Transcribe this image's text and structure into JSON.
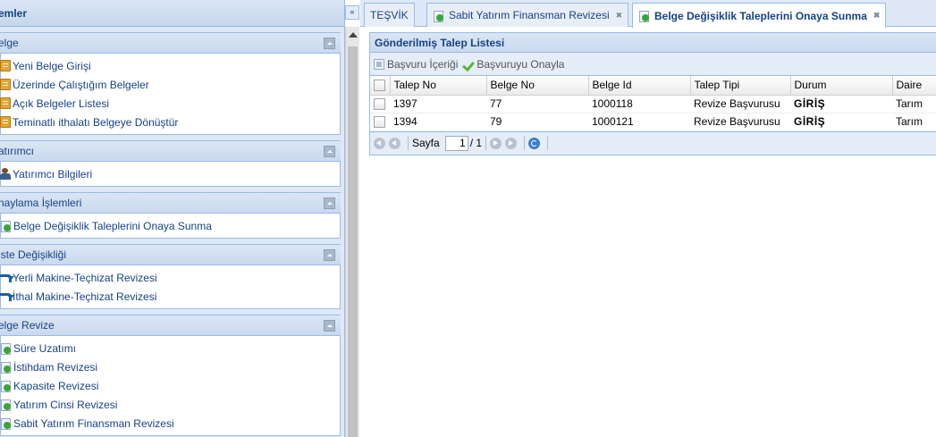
{
  "sidebar": {
    "title": "emler",
    "panels": [
      {
        "title": "elge",
        "items": [
          {
            "label": "Yeni Belge Girişi",
            "icon": "document-icon"
          },
          {
            "label": "Üzerinde Çalıştığım Belgeler",
            "icon": "document-icon"
          },
          {
            "label": "Açık Belgeler Listesi",
            "icon": "document-icon"
          },
          {
            "label": "Teminatlı ithalatı Belgeye Dönüştür",
            "icon": "document-icon"
          }
        ]
      },
      {
        "title": "atırımcı",
        "items": [
          {
            "label": "Yatırımcı Bilgileri",
            "icon": "user-icon"
          }
        ]
      },
      {
        "title": "naylama İşlemleri",
        "items": [
          {
            "label": "Belge Değişiklik Taleplerini Onaya Sunma",
            "icon": "page-go-icon"
          }
        ]
      },
      {
        "title": "iste Değişikliği",
        "items": [
          {
            "label": "Yerli Makine-Teçhizat Revizesi",
            "icon": "arrow-icon"
          },
          {
            "label": "İthal Makine-Teçhizat Revizesi",
            "icon": "arrow-icon"
          }
        ]
      },
      {
        "title": "elge Revize",
        "items": [
          {
            "label": "Süre Uzatımı",
            "icon": "page-go-icon"
          },
          {
            "label": "İstihdam Revizesi",
            "icon": "page-go-icon"
          },
          {
            "label": "Kapasite Revizesi",
            "icon": "page-go-icon"
          },
          {
            "label": "Yatırım Cinsi Revizesi",
            "icon": "page-go-icon"
          },
          {
            "label": "Sabit Yatırım Finansman Revizesi",
            "icon": "page-go-icon"
          }
        ]
      }
    ]
  },
  "tabs": [
    {
      "label": "TEŞVİK",
      "closable": false
    },
    {
      "label": "Sabit Yatırım Finansman Revizesi",
      "closable": true
    },
    {
      "label": "Belge Değişiklik Taleplerini Onaya Sunma",
      "closable": true
    }
  ],
  "grid": {
    "title": "Gönderilmiş Talep Listesi",
    "toolbar": {
      "view_label": "Başvuru İçeriği",
      "approve_label": "Başvuruyu Onayla"
    },
    "columns": [
      "Talep No",
      "Belge No",
      "Belge Id",
      "Talep Tipi",
      "Durum",
      "Daire"
    ],
    "rows": [
      {
        "talep_no": "1397",
        "belge_no": "77",
        "belge_id": "1000118",
        "talep_tipi": "Revize Başvurusu",
        "durum": "GİRİŞ",
        "daire": "Tarım"
      },
      {
        "talep_no": "1394",
        "belge_no": "79",
        "belge_id": "1000121",
        "talep_tipi": "Revize Başvurusu",
        "durum": "GİRİŞ",
        "daire": "Tarım"
      }
    ],
    "pager": {
      "page_label": "Sayfa",
      "current_page": "1",
      "total_label": "/ 1"
    }
  },
  "colors": {
    "header_text": "#15428b",
    "panel_bg": "#dfe8f6",
    "border": "#99bbe8"
  }
}
